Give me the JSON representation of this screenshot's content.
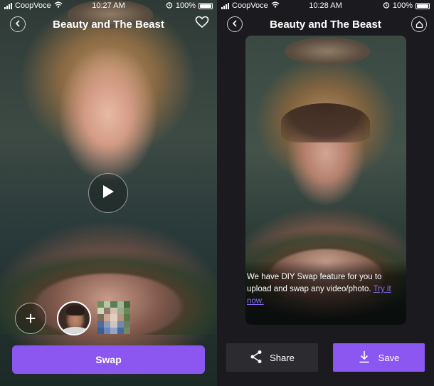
{
  "left": {
    "status": {
      "carrier": "CoopVoce",
      "time": "10:27 AM",
      "battery": "100%"
    },
    "title": "Beauty and The Beast",
    "add_label": "+",
    "swap_label": "Swap"
  },
  "right": {
    "status": {
      "carrier": "CoopVoce",
      "time": "10:28 AM",
      "battery": "100%"
    },
    "title": "Beauty and The Beast",
    "message": "We have DIY Swap feature for you to upload and swap any video/photo.",
    "try_link": "Try it now.",
    "share_label": "Share",
    "save_label": "Save"
  },
  "colors": {
    "accent": "#8c56f0",
    "dark_button": "#2b2b30",
    "background_dark": "#1b1b1f",
    "link": "#8e6cf5"
  },
  "icons": [
    "back-icon",
    "heart-icon",
    "play-icon",
    "plus-icon",
    "home-icon",
    "share-icon",
    "download-icon",
    "wifi-icon",
    "alarm-icon",
    "battery-icon",
    "signal-icon"
  ]
}
